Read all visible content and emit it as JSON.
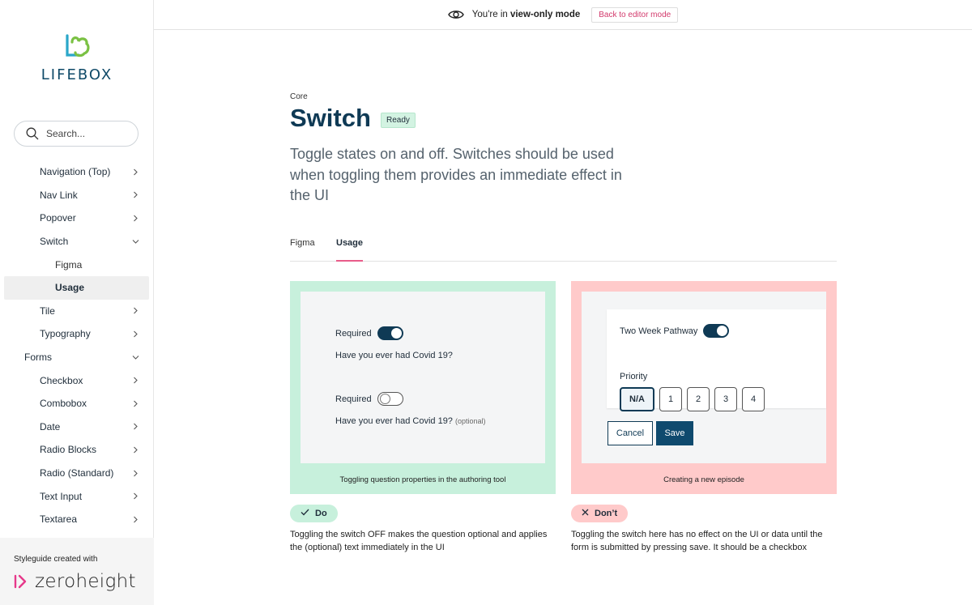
{
  "brand": {
    "name": "LIFEBOX"
  },
  "search": {
    "placeholder": "Search..."
  },
  "nav": {
    "items": [
      {
        "label": "Navigation (Top)"
      },
      {
        "label": "Nav Link"
      },
      {
        "label": "Popover"
      },
      {
        "label": "Switch"
      },
      {
        "label": "Figma"
      },
      {
        "label": "Usage"
      },
      {
        "label": "Tile"
      },
      {
        "label": "Typography"
      },
      {
        "label": "Forms"
      },
      {
        "label": "Checkbox"
      },
      {
        "label": "Combobox"
      },
      {
        "label": "Date"
      },
      {
        "label": "Radio Blocks"
      },
      {
        "label": "Radio (Standard)"
      },
      {
        "label": "Text Input"
      },
      {
        "label": "Textarea"
      }
    ]
  },
  "footer": {
    "caption": "Styleguide created with",
    "brand": "zeroheight"
  },
  "topbar": {
    "prefix": "You're in ",
    "mode": "view-only mode",
    "back_label": "Back to editor mode"
  },
  "page": {
    "breadcrumb": "Core",
    "title": "Switch",
    "status": "Ready",
    "description": "Toggle states on and off. Switches should be used when toggling them provides an immediate effect in the UI",
    "tabs": [
      {
        "label": "Figma"
      },
      {
        "label": "Usage"
      }
    ]
  },
  "do_card": {
    "row1_label": "Required",
    "row1_question": "Have you ever had Covid 19?",
    "row2_label": "Required",
    "row2_question": "Have you ever had Covid 19?",
    "row2_optional": "(optional)",
    "caption": "Toggling question properties in the authoring tool",
    "pill": "Do",
    "note": "Toggling the switch OFF makes the question optional and applies the (optional) text immediately in the UI"
  },
  "dont_card": {
    "switch_label": "Two Week Pathway",
    "priority_label": "Priority",
    "priority_options": [
      "N/A",
      "1",
      "2",
      "3",
      "4"
    ],
    "cancel": "Cancel",
    "save": "Save",
    "caption": "Creating a new episode",
    "pill": "Don’t",
    "note": "Toggling the switch here has no effect on the UI or data until the form is submitted by pressing save. It should be a checkbox"
  },
  "colors": {
    "brand": "#0f3a55",
    "accent": "#e95c8a",
    "do": "#c7f0dc",
    "dont": "#ffcaca"
  }
}
